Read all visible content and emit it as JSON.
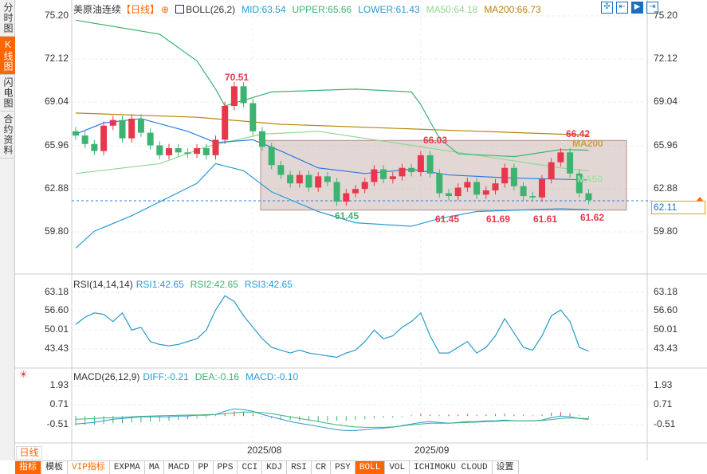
{
  "sidebar": {
    "tabs": [
      {
        "label": "分时图"
      },
      {
        "label": "K线图",
        "active": true
      },
      {
        "label": "闪电图"
      },
      {
        "label": "合约资料"
      }
    ]
  },
  "header": {
    "instrument": "美原油连续",
    "period": "【日线】",
    "indicator": "BOLL(26,2)",
    "mid": "MID:63.54",
    "upper": "UPPER:65.66",
    "lower": "LOWER:61.43",
    "ma50": "MA50:64.18",
    "ma200": "MA200:66.73"
  },
  "toolbar": {
    "icons": [
      "crosshair-icon",
      "zoom-fit-icon",
      "scroll-right-icon",
      "jump-latest-icon"
    ]
  },
  "price_axis": {
    "left": [
      "75.20",
      "72.12",
      "69.04",
      "65.96",
      "62.88",
      "59.80"
    ],
    "right": [
      "75.20",
      "72.12",
      "69.04",
      "65.96",
      "62.88",
      "59.80"
    ],
    "current": "62.11"
  },
  "annotations": {
    "high1": "70.51",
    "low1": "61.45",
    "high2": "66.03",
    "low2": "61.45",
    "low3": "61.69",
    "low4": "61.61",
    "high3": "66.42",
    "low5": "61.62",
    "ma200_label": "MA200",
    "ma50_label": "MA50"
  },
  "rsi": {
    "title": "RSI(14,14,14)",
    "rsi1": "RSI1:42.65",
    "rsi2": "RSI2:42.65",
    "rsi3": "RSI3:42.65",
    "axis": [
      "63.18",
      "56.60",
      "50.01",
      "43.43"
    ]
  },
  "macd": {
    "title": "MACD(26,12,9)",
    "diff": "DIFF:-0.21",
    "dea": "DEA:-0.16",
    "macd": "MACD:-0.10",
    "axis": [
      "1.93",
      "0.71",
      "-0.51"
    ]
  },
  "period_selector": "日线▲",
  "dates": [
    "2025/08",
    "2025/09"
  ],
  "bottom_tabs": [
    "指标",
    "模板",
    "VIP指标",
    "EXPMA",
    "MA",
    "MACD",
    "PP",
    "PPS",
    "CCI",
    "KDJ",
    "RSI",
    "CR",
    "PSY",
    "BOLL",
    "VOL",
    "ICHIMOKU CLOUD",
    "设置"
  ],
  "active_bottom_tab": "BOLL",
  "colors": {
    "up": "#e8364a",
    "down": "#3cb371",
    "upper": "#3cb371",
    "lower": "#2a9bd6",
    "mid": "#2a7be4",
    "ma50": "#90d890",
    "ma200": "#b8860b",
    "accent": "#ff6600"
  },
  "chart_data": {
    "type": "candlestick",
    "price_range": [
      59.8,
      75.2
    ],
    "closes": [
      66.7,
      66.1,
      65.6,
      67.4,
      67.8,
      66.5,
      67.9,
      66.9,
      66.0,
      65.3,
      65.8,
      65.5,
      65.4,
      65.8,
      65.3,
      66.4,
      68.8,
      70.2,
      69.0,
      67.0,
      65.9,
      64.6,
      63.9,
      63.3,
      63.9,
      63.0,
      63.8,
      63.4,
      62.0,
      62.6,
      62.9,
      63.4,
      64.3,
      63.6,
      63.8,
      64.4,
      64.1,
      65.3,
      64.0,
      62.6,
      62.4,
      63.0,
      63.4,
      62.5,
      62.8,
      63.3,
      64.4,
      63.1,
      62.4,
      62.3,
      63.6,
      64.8,
      65.5,
      64.0,
      62.6,
      62.11
    ],
    "upper": [
      [
        0,
        74.9
      ],
      [
        9,
        73.9
      ],
      [
        13,
        72.0
      ],
      [
        15,
        70.0
      ],
      [
        16,
        68.8
      ],
      [
        18,
        69.2
      ],
      [
        21,
        69.8
      ],
      [
        30,
        70.0
      ],
      [
        36,
        69.8
      ],
      [
        37,
        68.9
      ],
      [
        39,
        66.5
      ],
      [
        41,
        65.4
      ],
      [
        47,
        65.2
      ],
      [
        52,
        65.7
      ],
      [
        55,
        65.66
      ]
    ],
    "lower": [
      [
        0,
        58.7
      ],
      [
        2,
        59.9
      ],
      [
        6,
        61.0
      ],
      [
        13,
        63.3
      ],
      [
        15,
        64.7
      ],
      [
        18,
        64.2
      ],
      [
        21,
        62.7
      ],
      [
        26,
        61.3
      ],
      [
        30,
        60.5
      ],
      [
        36,
        60.25
      ],
      [
        39,
        60.8
      ],
      [
        43,
        61.3
      ],
      [
        52,
        61.5
      ],
      [
        55,
        61.43
      ]
    ],
    "mid": [
      [
        0,
        66.8
      ],
      [
        3,
        67.6
      ],
      [
        7,
        67.9
      ],
      [
        12,
        67.0
      ],
      [
        15,
        66.2
      ],
      [
        19,
        66.4
      ],
      [
        22,
        65.6
      ],
      [
        26,
        64.4
      ],
      [
        31,
        64.0
      ],
      [
        36,
        64.3
      ],
      [
        40,
        63.9
      ],
      [
        46,
        63.7
      ],
      [
        55,
        63.54
      ]
    ],
    "ma50": [
      [
        0,
        64.0
      ],
      [
        9,
        64.7
      ],
      [
        14,
        65.9
      ],
      [
        20,
        66.8
      ],
      [
        26,
        67.0
      ],
      [
        35,
        66.1
      ],
      [
        43,
        65.3
      ],
      [
        52,
        64.4
      ],
      [
        55,
        64.18
      ]
    ],
    "ma200": [
      [
        0,
        68.3
      ],
      [
        13,
        68.0
      ],
      [
        22,
        67.5
      ],
      [
        39,
        67.1
      ],
      [
        55,
        66.73
      ]
    ],
    "box": {
      "from_index": 20,
      "price_high": 66.35,
      "price_low": 61.4
    },
    "rsi_range": [
      43.43,
      63.18
    ],
    "rsi": [
      52,
      54.5,
      56,
      55.5,
      53,
      56,
      50,
      51,
      46,
      45,
      44.5,
      45,
      46,
      47,
      50,
      57,
      62,
      60,
      55,
      51,
      47,
      44,
      43,
      42,
      43,
      42,
      41.5,
      41,
      40.5,
      42,
      43,
      46,
      50,
      47,
      48,
      51,
      53,
      56,
      48,
      42,
      42,
      44,
      46,
      42,
      44,
      48,
      54,
      49,
      44,
      43,
      48,
      55,
      57,
      53,
      44,
      42.65
    ],
    "macd_range": [
      -0.51,
      1.93
    ],
    "macd_hist": [
      -0.6,
      -0.55,
      -0.55,
      -0.5,
      -0.45,
      -0.45,
      -0.4,
      -0.4,
      -0.35,
      -0.35,
      -0.3,
      -0.25,
      -0.2,
      -0.15,
      -0.1,
      0.05,
      0.15,
      0.3,
      0.25,
      0.15,
      -0.05,
      -0.15,
      -0.2,
      -0.25,
      -0.3,
      -0.3,
      -0.35,
      -0.35,
      -0.3,
      -0.3,
      -0.25,
      -0.2,
      -0.15,
      -0.1,
      -0.1,
      -0.05,
      0.05,
      0.15,
      0.1,
      0.05,
      0.1,
      0.1,
      0.12,
      0.08,
      0.1,
      0.12,
      0.15,
      0.1,
      0.08,
      0.05,
      0.1,
      0.2,
      0.25,
      0.15,
      0.05,
      -0.1
    ],
    "diff": [
      -0.5,
      -0.45,
      -0.4,
      -0.3,
      -0.2,
      -0.15,
      -0.1,
      -0.05,
      -0.05,
      -0.05,
      -0.05,
      0,
      0,
      0.05,
      0.05,
      0.1,
      0.3,
      0.45,
      0.4,
      0.3,
      0.1,
      -0.05,
      -0.2,
      -0.35,
      -0.45,
      -0.55,
      -0.65,
      -0.75,
      -0.85,
      -0.9,
      -0.9,
      -0.85,
      -0.8,
      -0.75,
      -0.7,
      -0.6,
      -0.5,
      -0.4,
      -0.35,
      -0.4,
      -0.45,
      -0.4,
      -0.35,
      -0.35,
      -0.3,
      -0.3,
      -0.25,
      -0.3,
      -0.3,
      -0.3,
      -0.25,
      -0.1,
      0,
      -0.05,
      -0.15,
      -0.21
    ],
    "dea": [
      -0.2,
      -0.18,
      -0.15,
      -0.12,
      -0.1,
      -0.08,
      -0.05,
      -0.02,
      0,
      0.02,
      0.03,
      0.05,
      0.06,
      0.07,
      0.08,
      0.1,
      0.15,
      0.2,
      0.25,
      0.25,
      0.22,
      0.15,
      0.05,
      -0.05,
      -0.15,
      -0.25,
      -0.35,
      -0.45,
      -0.55,
      -0.62,
      -0.68,
      -0.7,
      -0.7,
      -0.7,
      -0.68,
      -0.62,
      -0.55,
      -0.5,
      -0.45,
      -0.45,
      -0.45,
      -0.42,
      -0.4,
      -0.38,
      -0.35,
      -0.33,
      -0.3,
      -0.3,
      -0.3,
      -0.3,
      -0.28,
      -0.22,
      -0.15,
      -0.12,
      -0.14,
      -0.16
    ]
  }
}
